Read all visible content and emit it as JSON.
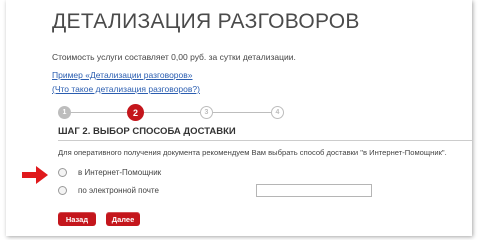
{
  "page": {
    "title": "ДЕТАЛИЗАЦИЯ РАЗГОВОРОВ",
    "cost_text": "Стоимость услуги составляет 0,00 руб. за сутки детализации.",
    "links": {
      "example": "Пример «Детализации разговоров»",
      "what_is": "(Что такое детализация разговоров?)"
    }
  },
  "steps": [
    {
      "label": "1",
      "state": "done"
    },
    {
      "label": "2",
      "state": "active"
    },
    {
      "label": "3",
      "state": "todo"
    },
    {
      "label": "4",
      "state": "todo"
    }
  ],
  "step_title": "ШАГ 2. ВЫБОР СПОСОБА ДОСТАВКИ",
  "description": "Для оперативного получения документа рекомендуем Вам выбрать способ доставки \"в Интернет-Помощник\".",
  "options": [
    {
      "label": "в Интернет-Помощник",
      "selected": false
    },
    {
      "label": "по электронной почте",
      "selected": false
    }
  ],
  "email": {
    "value": ""
  },
  "buttons": {
    "back": "Назад",
    "next": "Далее"
  },
  "colors": {
    "accent": "#c4161c",
    "link": "#2a5db0",
    "arrow": "#e0191c"
  }
}
